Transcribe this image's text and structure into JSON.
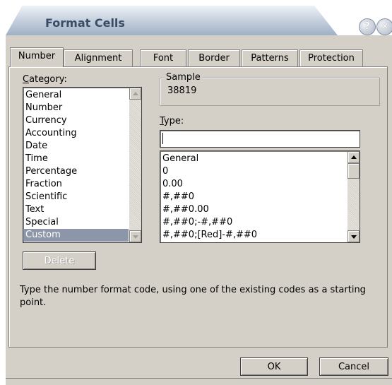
{
  "window": {
    "title": "Format Cells",
    "help_glyph": "?",
    "close_glyph": "×"
  },
  "tabs": [
    {
      "label": "Number",
      "active": true
    },
    {
      "label": "Alignment",
      "active": false
    },
    {
      "label": "Font",
      "active": false
    },
    {
      "label": "Border",
      "active": false
    },
    {
      "label": "Patterns",
      "active": false
    },
    {
      "label": "Protection",
      "active": false
    }
  ],
  "category": {
    "label_prefix": "C",
    "label_rest": "ategory:",
    "items": [
      "General",
      "Number",
      "Currency",
      "Accounting",
      "Date",
      "Time",
      "Percentage",
      "Fraction",
      "Scientific",
      "Text",
      "Special",
      "Custom"
    ],
    "selected": "Custom"
  },
  "sample": {
    "title": "Sample",
    "value": "38819"
  },
  "type": {
    "label_prefix": "T",
    "label_rest": "ype:",
    "input_value": "",
    "formats": [
      "General",
      "0",
      "0.00",
      "#,##0",
      "#,##0.00",
      "#,##0;-#,##0",
      "#,##0;[Red]-#,##0"
    ]
  },
  "buttons": {
    "delete": "Delete",
    "ok": "OK",
    "cancel": "Cancel"
  },
  "description": "Type the number format code, using one of the existing codes as a starting point."
}
